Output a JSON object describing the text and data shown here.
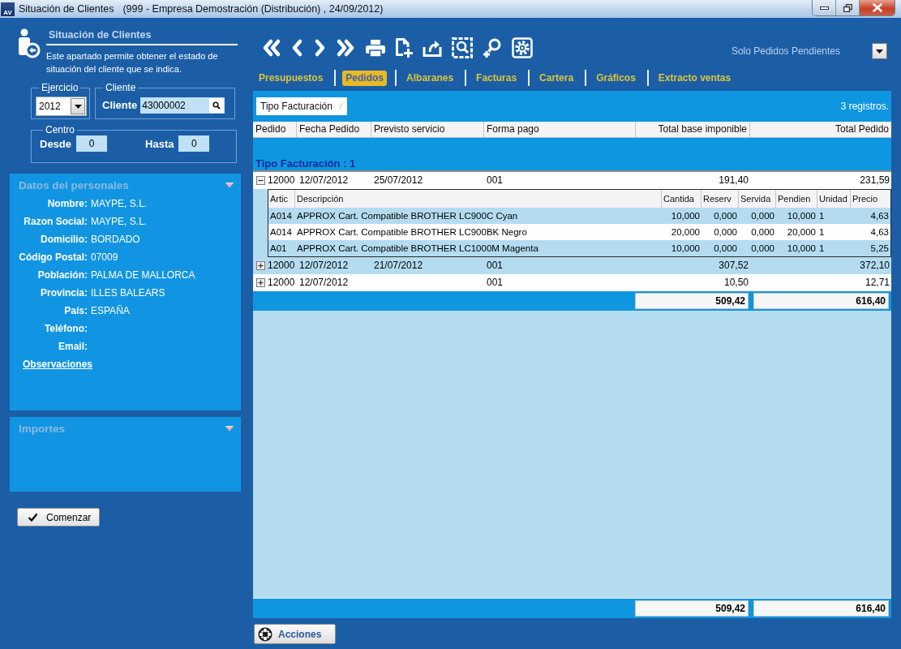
{
  "window": {
    "logo": "AV",
    "title": "Situación de Clientes",
    "subtitle": "(999 - Empresa Demostración (Distribución) , 24/09/2012)"
  },
  "intro": {
    "title": "Situación de Clientes",
    "description": "Este apartado permite obtener el estado de situación del cliente que se indica."
  },
  "filters": {
    "ejercicio": {
      "legend": "Ejercicio",
      "value": "2012"
    },
    "cliente": {
      "legend": "Cliente",
      "label": "Cliente",
      "value": "43000002"
    },
    "centro": {
      "legend": "Centro",
      "desde": {
        "label": "Desde",
        "value": "0"
      },
      "hasta": {
        "label": "Hasta",
        "value": "0"
      }
    }
  },
  "personal": {
    "title": "Datos del personales",
    "fields": [
      {
        "label": "Nombre:",
        "value": "MAYPE, S.L."
      },
      {
        "label": "Razon Social:",
        "value": "MAYPE, S.L."
      },
      {
        "label": "Domicilio:",
        "value": "BORDADO"
      },
      {
        "label": "Código Postal:",
        "value": "07009"
      },
      {
        "label": "Población:",
        "value": "PALMA DE MALLORCA"
      },
      {
        "label": "Provincia:",
        "value": "ILLES BALEARS"
      },
      {
        "label": "País:",
        "value": "ESPAÑA"
      },
      {
        "label": "Teléfono:"
      },
      {
        "label": "Email:"
      }
    ],
    "link": "Observaciones"
  },
  "importes": {
    "title": "Importes"
  },
  "start_button": "Comenzar",
  "pending_filter": {
    "label": "Solo Pedidos Pendientes"
  },
  "tabs": [
    {
      "label": "Presupuestos",
      "selected": false
    },
    {
      "label": "Pedidos",
      "selected": true
    },
    {
      "label": "Albaranes",
      "selected": false
    },
    {
      "label": "Facturas",
      "selected": false
    },
    {
      "label": "Cartera",
      "selected": false
    },
    {
      "label": "Gráficos",
      "selected": false
    },
    {
      "label": "Extracto ventas",
      "selected": false
    }
  ],
  "grid": {
    "group_by": "Tipo Facturación",
    "record_count": "3 registros.",
    "columns": [
      {
        "label": "Pedido",
        "kind": "text"
      },
      {
        "label": "Fecha Pedido",
        "kind": "text"
      },
      {
        "label": "Previsto servicio",
        "kind": "text"
      },
      {
        "label": "Forma pago",
        "kind": "text"
      },
      {
        "label": "Total base imponible",
        "kind": "number"
      },
      {
        "label": "Total Pedido",
        "kind": "number"
      }
    ],
    "group_label": "Tipo Facturación : 1",
    "rows": [
      {
        "expanded": true,
        "cells": [
          "12000",
          "12/07/2012",
          "25/07/2012",
          "001",
          "191,40",
          "231,59"
        ],
        "detail": {
          "columns": [
            {
              "label": "Artic",
              "kind": "text"
            },
            {
              "label": "Descripción",
              "kind": "text"
            },
            {
              "label": "Cantida",
              "kind": "number"
            },
            {
              "label": "Reserv",
              "kind": "number"
            },
            {
              "label": "Servida",
              "kind": "number"
            },
            {
              "label": "Pendien",
              "kind": "number"
            },
            {
              "label": "Unidad",
              "kind": "text"
            },
            {
              "label": "Precio",
              "kind": "number"
            }
          ],
          "rows": [
            [
              "A014",
              "APPROX Cart. Compatible BROTHER LC900C Cyan",
              "10,000",
              "0,000",
              "0,000",
              "10,000",
              "1",
              "4,63"
            ],
            [
              "A014",
              "APPROX Cart. Compatible BROTHER LC900BK Negro",
              "20,000",
              "0,000",
              "0,000",
              "20,000",
              "1",
              "4,63"
            ],
            [
              "A01",
              "APPROX Cart. Compatible BROTHER LC1000M Magenta",
              "10,000",
              "0,000",
              "0,000",
              "10,000",
              "1",
              "5,25"
            ]
          ]
        }
      },
      {
        "expanded": false,
        "cells": [
          "12000",
          "12/07/2012",
          "21/07/2012",
          "001",
          "307,52",
          "372,10"
        ]
      },
      {
        "expanded": false,
        "cells": [
          "12000",
          "12/07/2012",
          null,
          "001",
          "10,50",
          "12,71"
        ]
      }
    ],
    "group_totals": [
      "509,42",
      "616,40"
    ],
    "totals": [
      "509,42",
      "616,40"
    ]
  },
  "actions_button": "Acciones"
}
